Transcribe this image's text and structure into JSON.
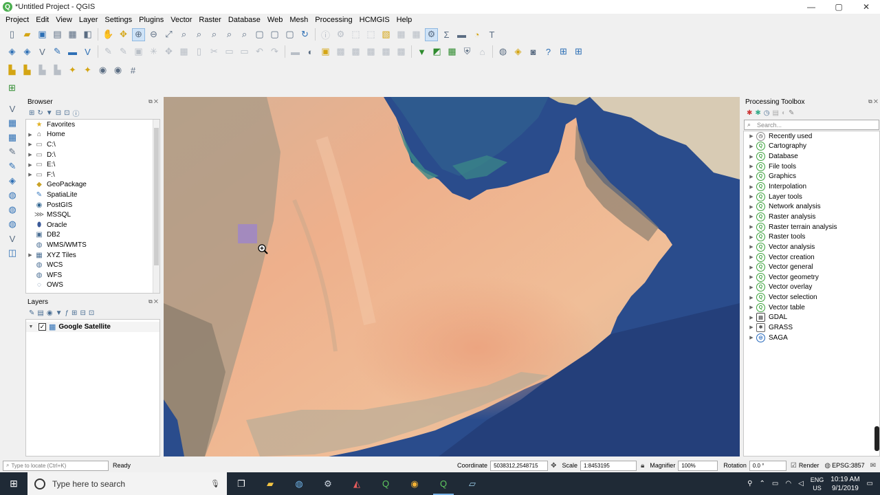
{
  "window": {
    "title": "*Untitled Project - QGIS",
    "minimize": "—",
    "maximize": "▢",
    "close": "✕"
  },
  "menu": [
    "Project",
    "Edit",
    "View",
    "Layer",
    "Settings",
    "Plugins",
    "Vector",
    "Raster",
    "Database",
    "Web",
    "Mesh",
    "Processing",
    "HCMGIS",
    "Help"
  ],
  "browser": {
    "title": "Browser",
    "items": [
      {
        "label": "Favorites",
        "icon": "star-icon",
        "glyph": "★",
        "color": "#e0b020",
        "expandable": false
      },
      {
        "label": "Home",
        "icon": "home-icon",
        "glyph": "⌂",
        "color": "#555555",
        "expandable": true
      },
      {
        "label": "C:\\",
        "icon": "drive-icon",
        "glyph": "▭",
        "color": "#777777",
        "expandable": true
      },
      {
        "label": "D:\\",
        "icon": "drive-icon",
        "glyph": "▭",
        "color": "#777777",
        "expandable": true
      },
      {
        "label": "E:\\",
        "icon": "drive-icon",
        "glyph": "▭",
        "color": "#777777",
        "expandable": true
      },
      {
        "label": "F:\\",
        "icon": "drive-icon",
        "glyph": "▭",
        "color": "#777777",
        "expandable": true
      },
      {
        "label": "GeoPackage",
        "icon": "geopackage-icon",
        "glyph": "◆",
        "color": "#c9a227",
        "expandable": false
      },
      {
        "label": "SpatiaLite",
        "icon": "spatialite-icon",
        "glyph": "✎",
        "color": "#3a7bbf",
        "expandable": false
      },
      {
        "label": "PostGIS",
        "icon": "postgis-icon",
        "glyph": "◉",
        "color": "#336791",
        "expandable": false
      },
      {
        "label": "MSSQL",
        "icon": "mssql-icon",
        "glyph": "⋙",
        "color": "#666666",
        "expandable": false
      },
      {
        "label": "Oracle",
        "icon": "oracle-icon",
        "glyph": "⬮",
        "color": "#3b5998",
        "expandable": false
      },
      {
        "label": "DB2",
        "icon": "db2-icon",
        "glyph": "▣",
        "color": "#4a6e93",
        "expandable": false
      },
      {
        "label": "WMS/WMTS",
        "icon": "globe-icon",
        "glyph": "◍",
        "color": "#4a6e93",
        "expandable": false
      },
      {
        "label": "XYZ Tiles",
        "icon": "xyz-tiles-icon",
        "glyph": "▦",
        "color": "#4a6e93",
        "expandable": true
      },
      {
        "label": "WCS",
        "icon": "globe-icon",
        "glyph": "◍",
        "color": "#4a6e93",
        "expandable": false
      },
      {
        "label": "WFS",
        "icon": "globe-icon",
        "glyph": "◍",
        "color": "#4a6e93",
        "expandable": false
      },
      {
        "label": "OWS",
        "icon": "globe-icon",
        "glyph": "◌",
        "color": "#4a6e93",
        "expandable": false
      }
    ]
  },
  "layers": {
    "title": "Layers",
    "items": [
      {
        "label": "Google Satellite",
        "checked": true
      }
    ]
  },
  "toolbox": {
    "title": "Processing Toolbox",
    "search_placeholder": "Search...",
    "items": [
      {
        "label": "Recently used",
        "kind": "clock",
        "glyph": "◷"
      },
      {
        "label": "Cartography",
        "kind": "qgis",
        "glyph": "Q"
      },
      {
        "label": "Database",
        "kind": "qgis",
        "glyph": "Q"
      },
      {
        "label": "File tools",
        "kind": "qgis",
        "glyph": "Q"
      },
      {
        "label": "Graphics",
        "kind": "qgis",
        "glyph": "Q"
      },
      {
        "label": "Interpolation",
        "kind": "qgis",
        "glyph": "Q"
      },
      {
        "label": "Layer tools",
        "kind": "qgis",
        "glyph": "Q"
      },
      {
        "label": "Network analysis",
        "kind": "qgis",
        "glyph": "Q"
      },
      {
        "label": "Raster analysis",
        "kind": "qgis",
        "glyph": "Q"
      },
      {
        "label": "Raster terrain analysis",
        "kind": "qgis",
        "glyph": "Q"
      },
      {
        "label": "Raster tools",
        "kind": "qgis",
        "glyph": "Q"
      },
      {
        "label": "Vector analysis",
        "kind": "qgis",
        "glyph": "Q"
      },
      {
        "label": "Vector creation",
        "kind": "qgis",
        "glyph": "Q"
      },
      {
        "label": "Vector general",
        "kind": "qgis",
        "glyph": "Q"
      },
      {
        "label": "Vector geometry",
        "kind": "qgis",
        "glyph": "Q"
      },
      {
        "label": "Vector overlay",
        "kind": "qgis",
        "glyph": "Q"
      },
      {
        "label": "Vector selection",
        "kind": "qgis",
        "glyph": "Q"
      },
      {
        "label": "Vector table",
        "kind": "qgis",
        "glyph": "Q"
      },
      {
        "label": "GDAL",
        "kind": "gdal",
        "glyph": "▤"
      },
      {
        "label": "GRASS",
        "kind": "grass",
        "glyph": "✱"
      },
      {
        "label": "SAGA",
        "kind": "saga",
        "glyph": "◎"
      }
    ]
  },
  "status": {
    "locate_placeholder": "Type to locate (Ctrl+K)",
    "ready": "Ready",
    "coordinate_label": "Coordinate",
    "coordinate_value": "5038312,2548715",
    "scale_label": "Scale",
    "scale_value": "1:8453195",
    "magnifier_label": "Magnifier",
    "magnifier_value": "100%",
    "rotation_label": "Rotation",
    "rotation_value": "0.0 °",
    "render_label": "Render",
    "crs": "EPSG:3857"
  },
  "taskbar": {
    "search_placeholder": "Type here to search",
    "lang_top": "ENG",
    "lang_bottom": "US",
    "time": "10:19 AM",
    "date": "9/1/2019"
  },
  "colors": {
    "desert": "#e9b995",
    "sea": "#2c4f8e",
    "qgis_green": "#3aa13a",
    "accent": "#2d6fb5"
  }
}
